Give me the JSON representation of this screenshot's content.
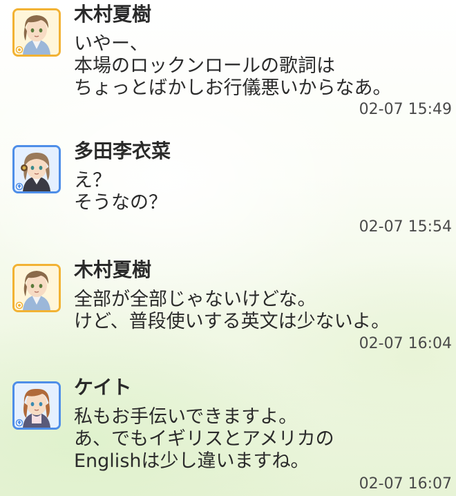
{
  "messages": [
    {
      "sender": "木村夏樹",
      "avatar_frame": "orange",
      "avatar_icon": "sun-badge-icon",
      "lines": [
        "いやー、",
        "本場のロックンロールの歌詞は",
        "ちょっとばかしお行儀悪いからなあ。"
      ],
      "time": "02-07 15:49"
    },
    {
      "sender": "多田李衣菜",
      "avatar_frame": "blue",
      "avatar_icon": "diamond-badge-icon",
      "lines": [
        "え？",
        "そうなの？"
      ],
      "time": "02-07 15:54"
    },
    {
      "sender": "木村夏樹",
      "avatar_frame": "orange",
      "avatar_icon": "sun-badge-icon",
      "lines": [
        "全部が全部じゃないけどな。",
        "けど、普段使いする英文は少ないよ。"
      ],
      "time": "02-07 16:04"
    },
    {
      "sender": "ケイト",
      "avatar_frame": "blue",
      "avatar_icon": "diamond-badge-icon",
      "lines": [
        "私もお手伝いできますよ。",
        "あ、でもイギリスとアメリカの",
        "Englishは少し違いますね。"
      ],
      "time": "02-07 16:07"
    }
  ],
  "colors": {
    "orange_frame": "#f2b233",
    "blue_frame": "#4e8ee8",
    "text": "#2b2b2b",
    "timestamp": "#4a4a4a"
  }
}
